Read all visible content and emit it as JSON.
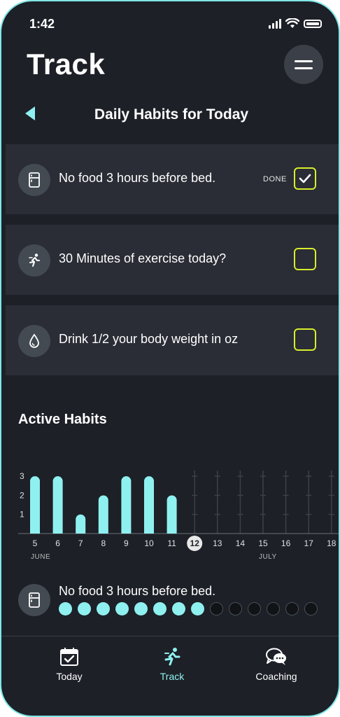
{
  "status": {
    "time": "1:42"
  },
  "header": {
    "title": "Track"
  },
  "section": {
    "title": "Daily Habits for Today"
  },
  "habits": [
    {
      "label": "No food 3 hours before bed.",
      "icon": "fridge-icon",
      "done": true,
      "done_label": "DONE"
    },
    {
      "label": "30 Minutes of exercise today?",
      "icon": "runner-icon",
      "done": false
    },
    {
      "label": "Drink 1/2 your body weight in oz",
      "icon": "water-drop-icon",
      "done": false
    }
  ],
  "active_habits": {
    "title": "Active Habits"
  },
  "chart_data": {
    "type": "bar",
    "categories": [
      "5",
      "6",
      "7",
      "8",
      "9",
      "10",
      "11",
      "12",
      "13",
      "14",
      "15",
      "16",
      "17",
      "18"
    ],
    "values": [
      3,
      3,
      1,
      2,
      3,
      3,
      2,
      null,
      null,
      null,
      null,
      null,
      null,
      null
    ],
    "yticks": [
      1,
      2,
      3
    ],
    "ylim": [
      0,
      3.3
    ],
    "highlight_category": "12",
    "month_labels": [
      {
        "label": "JUNE",
        "category": "5"
      },
      {
        "label": "JULY",
        "category": "15"
      }
    ],
    "bar_color": "#8ff0f0"
  },
  "progress": {
    "label": "No food 3 hours before bed.",
    "completed": 8,
    "total": 14
  },
  "nav": {
    "items": [
      {
        "label": "Today",
        "icon": "calendar-check-icon",
        "active": false
      },
      {
        "label": "Track",
        "icon": "runner-icon",
        "active": true
      },
      {
        "label": "Coaching",
        "icon": "chat-bubbles-icon",
        "active": false
      }
    ]
  },
  "colors": {
    "accent": "#8ff0f0",
    "checkbox": "#d8ee2c",
    "background": "#1d2027",
    "card": "#2a2d35"
  }
}
